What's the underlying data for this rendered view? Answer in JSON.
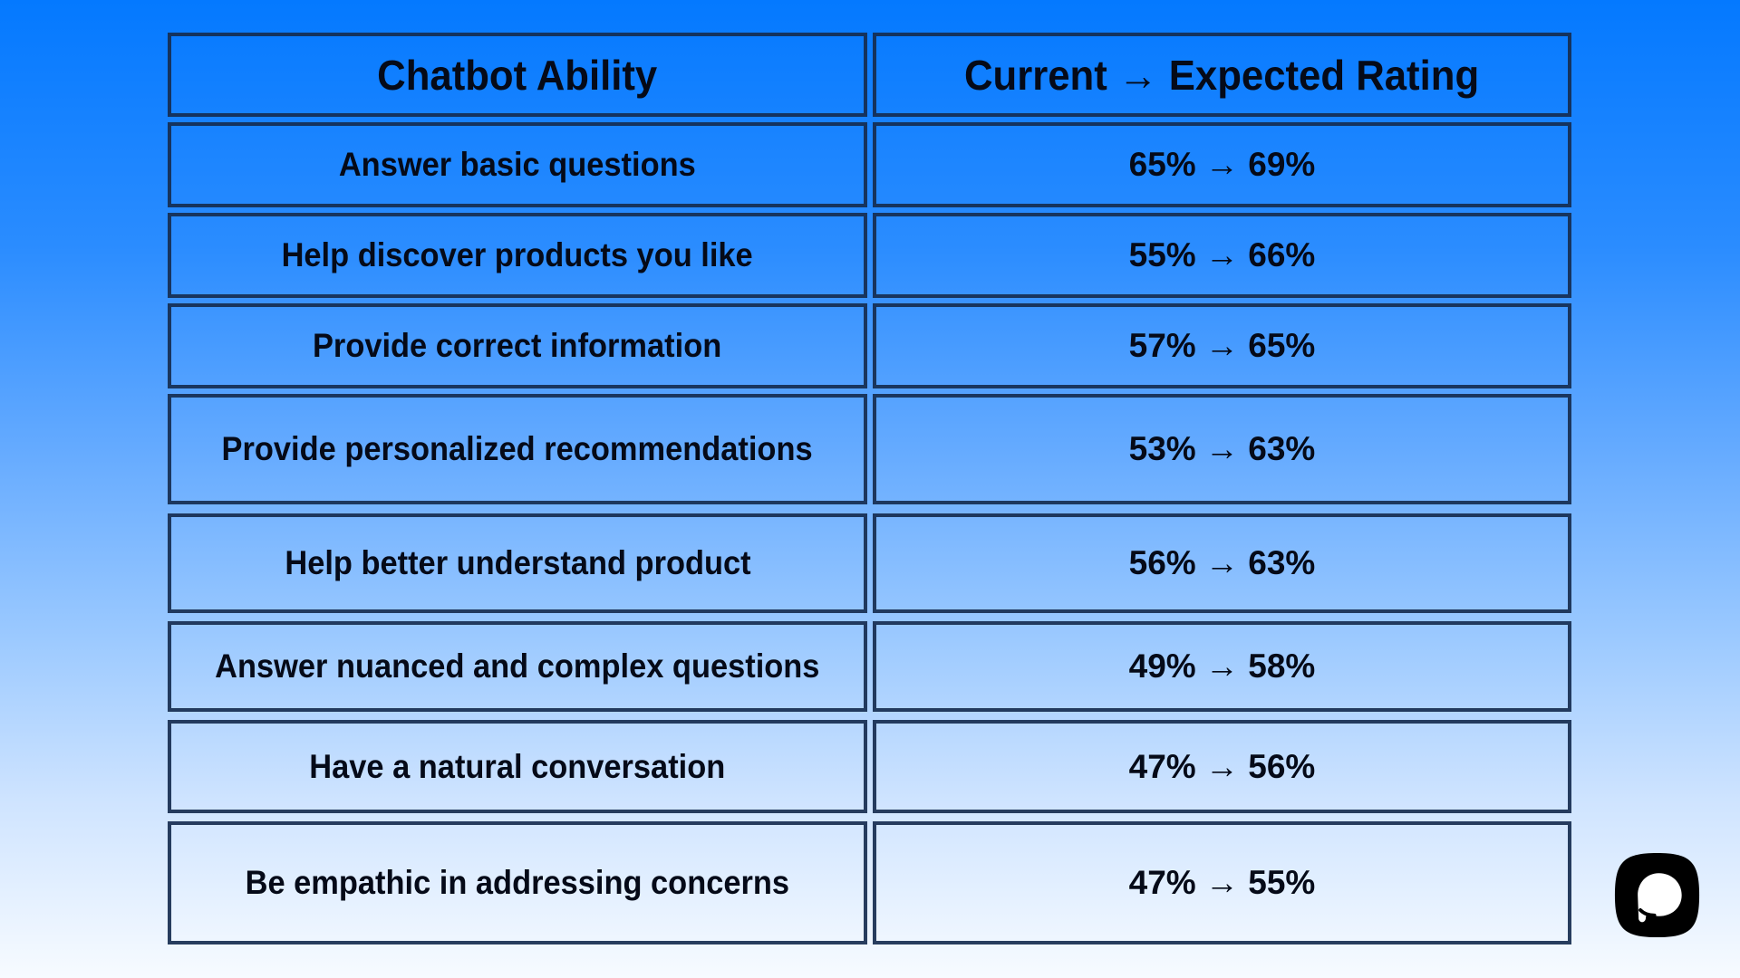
{
  "table": {
    "headers": {
      "ability": "Chatbot Ability",
      "rating": "Current → Expected Rating"
    },
    "rows": [
      {
        "ability": "Answer basic questions",
        "current": "65%",
        "expected": "69%",
        "rating": "65% → 69%"
      },
      {
        "ability": "Help discover products you like",
        "current": "55%",
        "expected": "66%",
        "rating": "55% → 66%"
      },
      {
        "ability": "Provide correct information",
        "current": "57%",
        "expected": "65%",
        "rating": "57% → 65%"
      },
      {
        "ability": "Provide personalized recommendations",
        "current": "53%",
        "expected": "63%",
        "rating": "53% → 63%"
      },
      {
        "ability": "Help better understand product",
        "current": "56%",
        "expected": "63%",
        "rating": "56% → 63%"
      },
      {
        "ability": "Answer nuanced and complex questions",
        "current": "49%",
        "expected": "58%",
        "rating": "49% → 58%"
      },
      {
        "ability": "Have a natural conversation",
        "current": "47%",
        "expected": "56%",
        "rating": "47% → 56%"
      },
      {
        "ability": "Be empathic in addressing concerns",
        "current": "47%",
        "expected": "55%",
        "rating": "47% → 55%"
      }
    ]
  },
  "logo": {
    "icon": "chat-bubble-logo-icon"
  },
  "colors": {
    "gradient_top": "#0479ff",
    "gradient_bottom": "#f7fbff",
    "border": "#162c50",
    "text": "#050a18"
  }
}
